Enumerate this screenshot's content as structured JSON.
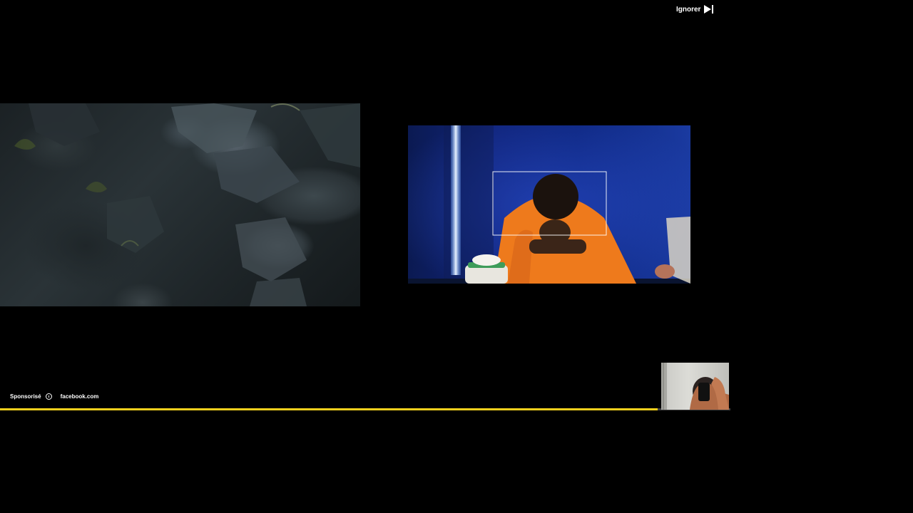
{
  "ad": {
    "skip_label": "Ignorer",
    "sponsored_label": "Sponsorisé",
    "source_domain": "facebook.com",
    "progress_fraction": 0.9,
    "accent_color": "#f5d01d"
  },
  "icons": {
    "skip": "skip-next-icon",
    "info": "info-icon"
  }
}
